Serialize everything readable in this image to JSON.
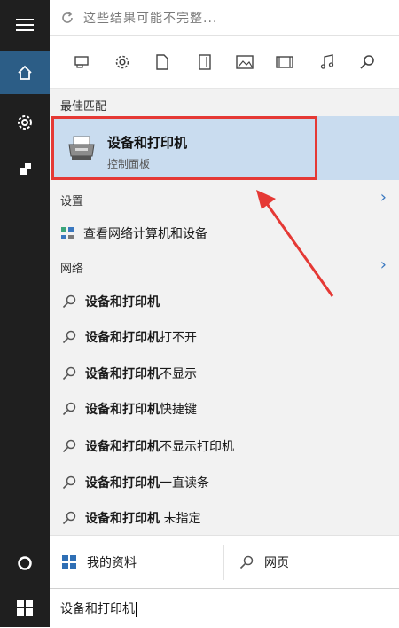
{
  "search": {
    "notice": "这些结果可能不完整...",
    "query": "设备和打印机"
  },
  "filters": [
    {
      "name": "apps-filter-icon"
    },
    {
      "name": "settings-filter-icon"
    },
    {
      "name": "documents-filter-icon"
    },
    {
      "name": "folders-filter-icon"
    },
    {
      "name": "photos-filter-icon"
    },
    {
      "name": "videos-filter-icon"
    },
    {
      "name": "music-filter-icon"
    },
    {
      "name": "web-filter-icon"
    }
  ],
  "best_match": {
    "heading": "最佳匹配",
    "title": "设备和打印机",
    "subtitle": "控制面板"
  },
  "settings": {
    "heading": "设置",
    "item": "查看网络计算机和设备"
  },
  "web": {
    "heading": "网络",
    "items": [
      {
        "bold": "设备和打印机",
        "rest": ""
      },
      {
        "bold": "设备和打印机",
        "rest": "打不开"
      },
      {
        "bold": "设备和打印机",
        "rest": "不显示"
      },
      {
        "bold": "设备和打印机",
        "rest": "快捷键"
      },
      {
        "bold": "设备和打印机",
        "rest": "不显示打印机"
      },
      {
        "bold": "设备和打印机",
        "rest": "一直读条"
      },
      {
        "bold": "设备和打印机",
        "rest": " 未指定"
      }
    ]
  },
  "bottom": {
    "my_stuff": "我的资料",
    "web": "网页"
  },
  "colors": {
    "accent": "#2c5d86",
    "highlight": "#c9dcef",
    "annotation": "#e53935"
  }
}
